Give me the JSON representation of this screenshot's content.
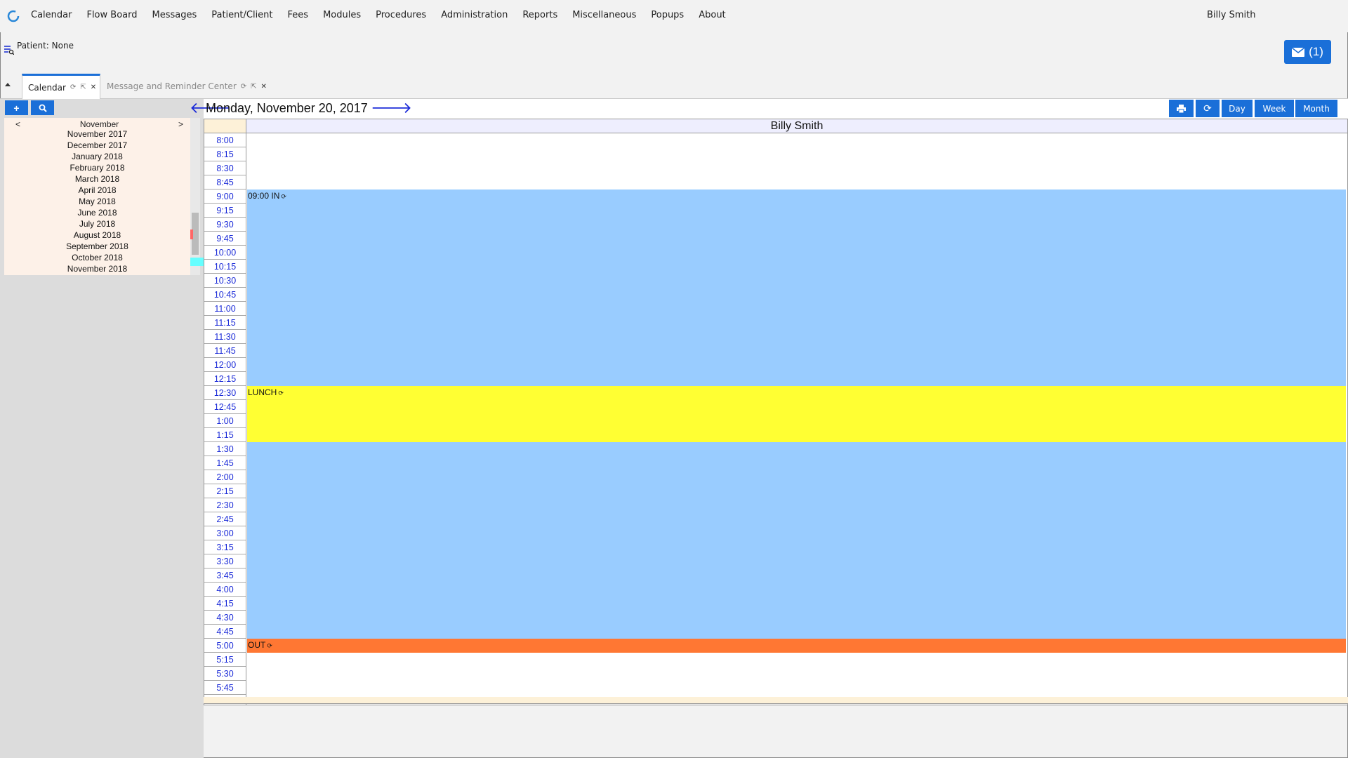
{
  "nav": {
    "items": [
      "Calendar",
      "Flow Board",
      "Messages",
      "Patient/Client",
      "Fees",
      "Modules",
      "Procedures",
      "Administration",
      "Reports",
      "Miscellaneous",
      "Popups",
      "About"
    ],
    "user": "Billy Smith"
  },
  "patient": {
    "label": "Patient: None"
  },
  "messages_badge": "(1)",
  "tabs": [
    {
      "label": "Calendar"
    },
    {
      "label": "Message and Reminder Center"
    }
  ],
  "mini_calendar": {
    "prev": "<",
    "next": ">",
    "current": "November",
    "months": [
      "November 2017",
      "December 2017",
      "January 2018",
      "February 2018",
      "March 2018",
      "April 2018",
      "May 2018",
      "June 2018",
      "July 2018",
      "August 2018",
      "September 2018",
      "October 2018",
      "November 2018"
    ]
  },
  "calendar": {
    "date": "Monday, November 20, 2017",
    "provider": "Billy Smith",
    "buttons": {
      "day": "Day",
      "week": "Week",
      "month": "Month"
    },
    "times": [
      "8:00",
      "8:15",
      "8:30",
      "8:45",
      "9:00",
      "9:15",
      "9:30",
      "9:45",
      "10:00",
      "10:15",
      "10:30",
      "10:45",
      "11:00",
      "11:15",
      "11:30",
      "11:45",
      "12:00",
      "12:15",
      "12:30",
      "12:45",
      "1:00",
      "1:15",
      "1:30",
      "1:45",
      "2:00",
      "2:15",
      "2:30",
      "2:45",
      "3:00",
      "3:15",
      "3:30",
      "3:45",
      "4:00",
      "4:15",
      "4:30",
      "4:45",
      "5:00",
      "5:15",
      "5:30",
      "5:45"
    ],
    "events": [
      {
        "label": "09:00 IN",
        "color": "#99ccff"
      },
      {
        "label": "LUNCH",
        "color": "#ffff33"
      },
      {
        "label": "",
        "color": "#99ccff"
      },
      {
        "label": "OUT",
        "color": "#ff7733"
      }
    ]
  },
  "colors": {
    "accent": "#1a6fd8",
    "arrow": "#1a2ad8"
  }
}
